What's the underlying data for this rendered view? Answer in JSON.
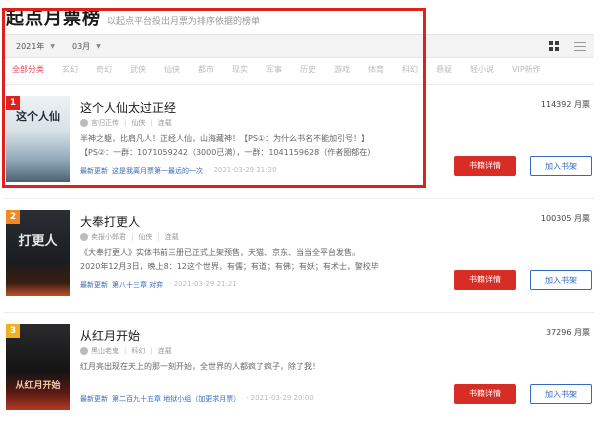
{
  "header": {
    "title": "起点月票榜",
    "subtitle": "以起点平台投出月票为排序依据的榜单"
  },
  "filters": {
    "year": "2021年",
    "month": "03月"
  },
  "categories": [
    "全部分类",
    "玄幻",
    "奇幻",
    "武侠",
    "仙侠",
    "都市",
    "现实",
    "军事",
    "历史",
    "游戏",
    "体育",
    "科幻",
    "悬疑",
    "轻小说",
    "VIP新作"
  ],
  "books": [
    {
      "rank": "1",
      "title": "这个人仙太过正经",
      "author": "言归正传",
      "genre": "仙侠",
      "status": "连载",
      "description": "半神之躯，比肩凡人！正经人仙，山海藏神！【PS①：为什么书名不能加引号！】【PS②：一群：1071059242（3000已满），一群：1041159628（作者圈郁在）继续仙侠",
      "update_label": "最新更新",
      "update_chapter": "这是我离月票第一最远的一次",
      "update_time": "· 2021-03-29 21:20",
      "votes": "114392 月票",
      "cover_text": "这个人仙",
      "detail_label": "书籍详情",
      "shelf_label": "加入书架"
    },
    {
      "rank": "2",
      "title": "大奉打更人",
      "author": "卖报小郎君",
      "genre": "仙侠",
      "status": "连载",
      "description": "《大奉打更人》实体书前三册已正式上架预售，天猫、京东、当当全平台发售。2020年12月3日，晚上8：12这个世界，有儒；有道；有佛；有妖；有术士，警校毕业的许七安幽",
      "update_label": "最新更新",
      "update_chapter": "第八十三章 对弈",
      "update_time": "· 2021-03-29 21:21",
      "votes": "100305 月票",
      "cover_text": "打更人",
      "detail_label": "书籍详情",
      "shelf_label": "加入书架"
    },
    {
      "rank": "3",
      "title": "从红月开始",
      "author": "黑山老鬼",
      "genre": "科幻",
      "status": "连载",
      "description": "红月亮出现在天上的那一刻开始，全世界的人都疯了疯子，除了我！",
      "update_label": "最新更新",
      "update_chapter": "第二百九十五章 地狱小组（加更求月票）",
      "update_time": "· 2021-03-29 20:00",
      "votes": "37296 月票",
      "cover_text": "从红月开始",
      "detail_label": "书籍详情",
      "shelf_label": "加入书架"
    }
  ]
}
